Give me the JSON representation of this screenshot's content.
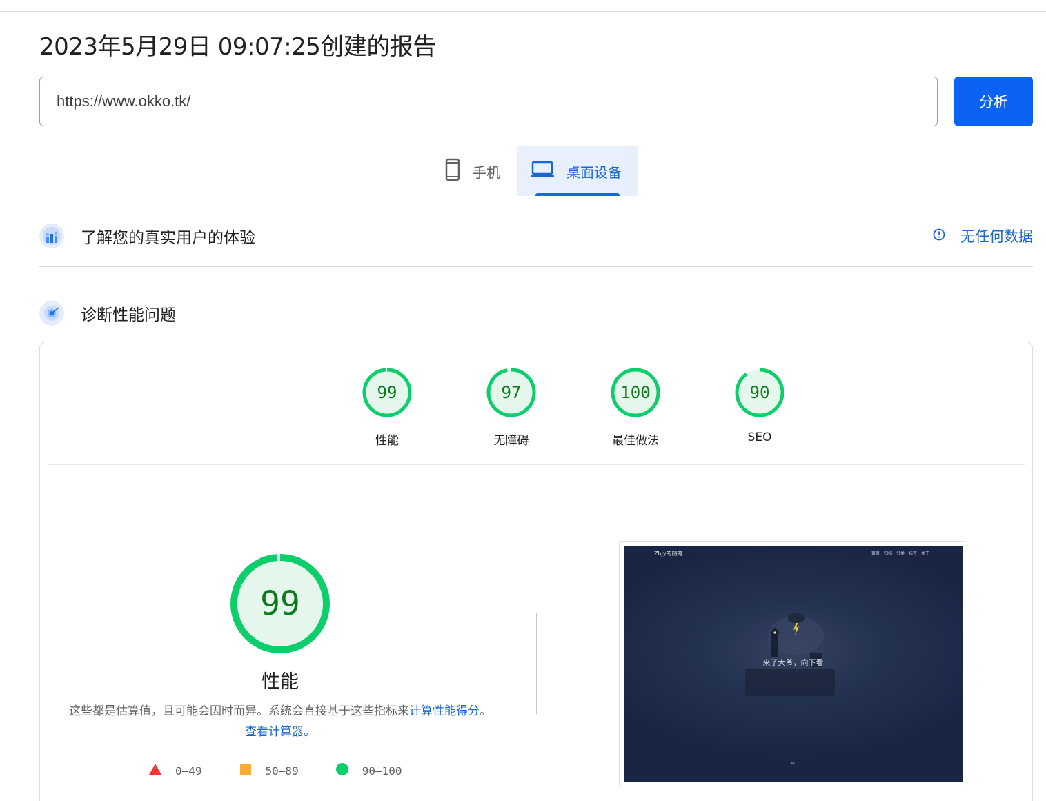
{
  "header": {
    "title": "2023年5月29日 09:07:25创建的报告"
  },
  "search": {
    "url_value": "https://www.okko.tk/",
    "analyze_label": "分析"
  },
  "device_tabs": [
    {
      "label": "手机",
      "icon": "phone-icon",
      "active": false
    },
    {
      "label": "桌面设备",
      "icon": "laptop-icon",
      "active": true
    }
  ],
  "crux": {
    "title": "了解您的真实用户的体验",
    "icon": "crux-icon",
    "status_icon": "info-icon",
    "status_text": "无任何数据"
  },
  "diagnose": {
    "title": "诊断性能问题",
    "icon": "lighthouse-icon"
  },
  "scores": [
    {
      "label": "性能",
      "value": "99"
    },
    {
      "label": "无障碍",
      "value": "97"
    },
    {
      "label": "最佳做法",
      "value": "100"
    },
    {
      "label": "SEO",
      "value": "90"
    }
  ],
  "performance": {
    "score": "99",
    "label": "性能",
    "desc_text": "这些都是估算值，且可能会因时而异。系统会直接基于这些指标来",
    "desc_link1": "计算性能得分",
    "desc_mid": "。",
    "desc_link2": "查看计算器。"
  },
  "legend": [
    {
      "range": "0–49",
      "shape": "triangle",
      "color": "#ff3333"
    },
    {
      "range": "50–89",
      "shape": "square",
      "color": "#ffaa33"
    },
    {
      "range": "90–100",
      "shape": "circle",
      "color": "#0cce6b"
    }
  ],
  "screenshot": {
    "brand": "ZhJy的随笔",
    "nav": [
      "首页",
      "归档",
      "分类",
      "标签",
      "关于"
    ],
    "slogan": "来了大爷，向下看",
    "chevron": "⌄"
  },
  "colors": {
    "pass_ring": "#0cce6b",
    "pass_fill": "#e5f7ec",
    "pass_text": "#0c7a18",
    "accent": "#1967d2",
    "button": "#0b63f3"
  }
}
